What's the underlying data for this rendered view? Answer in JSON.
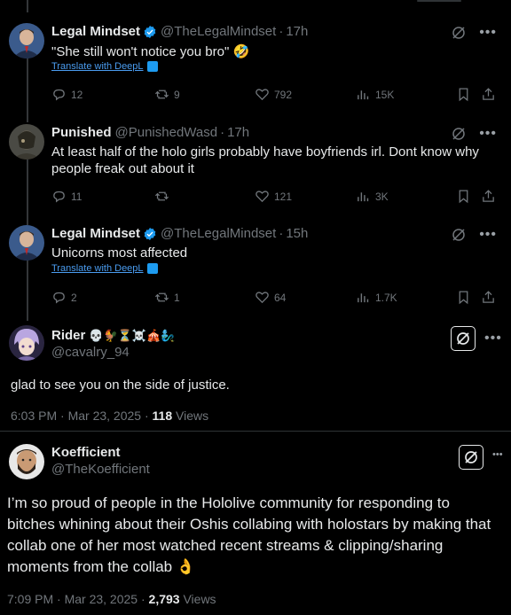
{
  "replies": [
    {
      "name": "Legal Mindset",
      "verified": true,
      "handle": "@TheLegalMindset",
      "time": "17h",
      "text": "\"She still won't notice you bro\" 🤣",
      "translate": "Translate with DeepL",
      "replies": "12",
      "reposts": "9",
      "likes": "792",
      "views": "15K"
    },
    {
      "name": "Punished",
      "verified": false,
      "handle": "@PunishedWasd",
      "time": "17h",
      "text": "At least half of the holo girls probably have boyfriends irl. Dont know why people freak out about it",
      "translate": "",
      "replies": "11",
      "reposts": "",
      "likes": "121",
      "views": "3K"
    },
    {
      "name": "Legal Mindset",
      "verified": true,
      "handle": "@TheLegalMindset",
      "time": "15h",
      "text": "Unicorns most affected",
      "translate": "Translate with DeepL",
      "replies": "2",
      "reposts": "1",
      "likes": "64",
      "views": "1.7K"
    }
  ],
  "rider": {
    "name": "Rider",
    "emojis": "💀🐓⏳☠️🎪🧞‍♂️",
    "handle": "@cavalry_94",
    "text": "glad to see you on the side of justice.",
    "time": "6:03 PM · Mar 23, 2025 · ",
    "views_count": "118",
    "views_label": " Views"
  },
  "koef": {
    "name": "Koefficient",
    "handle": "@TheKoefficient",
    "text": "I’m so proud of people in the Hololive community for responding to bitches whining about their Oshis collabing with holostars by making that collab one of her most watched recent streams & clipping/sharing moments from the collab 👌",
    "time": "7:09 PM · Mar 23, 2025 · ",
    "views_count": "2,793",
    "views_label": " Views"
  },
  "colors": {
    "background": "#000000",
    "verified": "#1d9bf0",
    "muted": "#71767b",
    "text": "#e7e9ea"
  },
  "icons": [
    "grok-icon",
    "more-icon",
    "reply-icon",
    "repost-icon",
    "like-icon",
    "views-icon",
    "bookmark-icon",
    "share-icon"
  ]
}
